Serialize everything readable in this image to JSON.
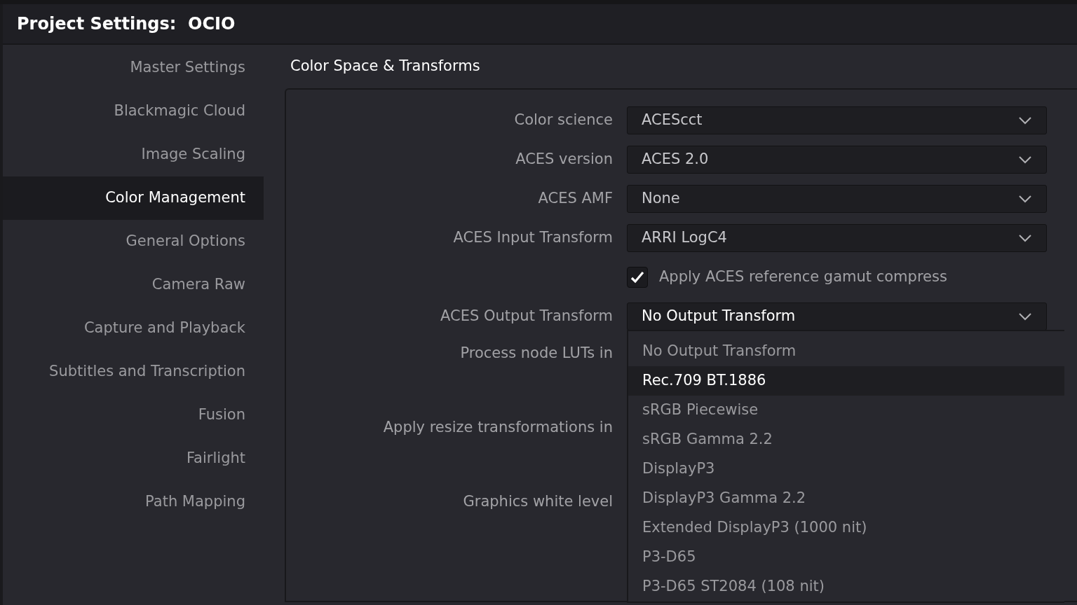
{
  "window": {
    "title": "Project Settings:  OCIO"
  },
  "sidebar": {
    "items": [
      {
        "label": "Master Settings",
        "selected": false
      },
      {
        "label": "Blackmagic Cloud",
        "selected": false
      },
      {
        "label": "Image Scaling",
        "selected": false
      },
      {
        "label": "Color Management",
        "selected": true
      },
      {
        "label": "General Options",
        "selected": false
      },
      {
        "label": "Camera Raw",
        "selected": false
      },
      {
        "label": "Capture and Playback",
        "selected": false
      },
      {
        "label": "Subtitles and Transcription",
        "selected": false
      },
      {
        "label": "Fusion",
        "selected": false
      },
      {
        "label": "Fairlight",
        "selected": false
      },
      {
        "label": "Path Mapping",
        "selected": false
      }
    ]
  },
  "section": {
    "title": "Color Space & Transforms",
    "rows": [
      {
        "kind": "select",
        "label": "Color science",
        "value": "ACEScct",
        "expanded": false
      },
      {
        "kind": "select",
        "label": "ACES version",
        "value": "ACES 2.0",
        "expanded": false
      },
      {
        "kind": "select",
        "label": "ACES AMF",
        "value": "None",
        "expanded": false
      },
      {
        "kind": "select",
        "label": "ACES Input Transform",
        "value": "ARRI LogC4",
        "expanded": false
      },
      {
        "kind": "checkbox",
        "label": "Apply ACES reference gamut compress",
        "checked": true
      },
      {
        "kind": "select",
        "label": "ACES Output Transform",
        "value": "No Output Transform",
        "expanded": true,
        "options": [
          {
            "label": "No Output Transform",
            "highlighted": false
          },
          {
            "label": "Rec.709 BT.1886",
            "highlighted": true
          },
          {
            "label": "sRGB Piecewise",
            "highlighted": false
          },
          {
            "label": "sRGB Gamma 2.2",
            "highlighted": false
          },
          {
            "label": "DisplayP3",
            "highlighted": false
          },
          {
            "label": "DisplayP3 Gamma 2.2",
            "highlighted": false
          },
          {
            "label": "Extended DisplayP3 (1000 nit)",
            "highlighted": false
          },
          {
            "label": "P3-D65",
            "highlighted": false
          },
          {
            "label": "P3-D65 ST2084 (108 nit)",
            "highlighted": false
          }
        ]
      },
      {
        "kind": "hidden",
        "label": "Process node LUTs in"
      },
      {
        "kind": "hidden",
        "label": "Apply resize transformations in"
      },
      {
        "kind": "hidden",
        "label": "Graphics white level"
      }
    ]
  }
}
